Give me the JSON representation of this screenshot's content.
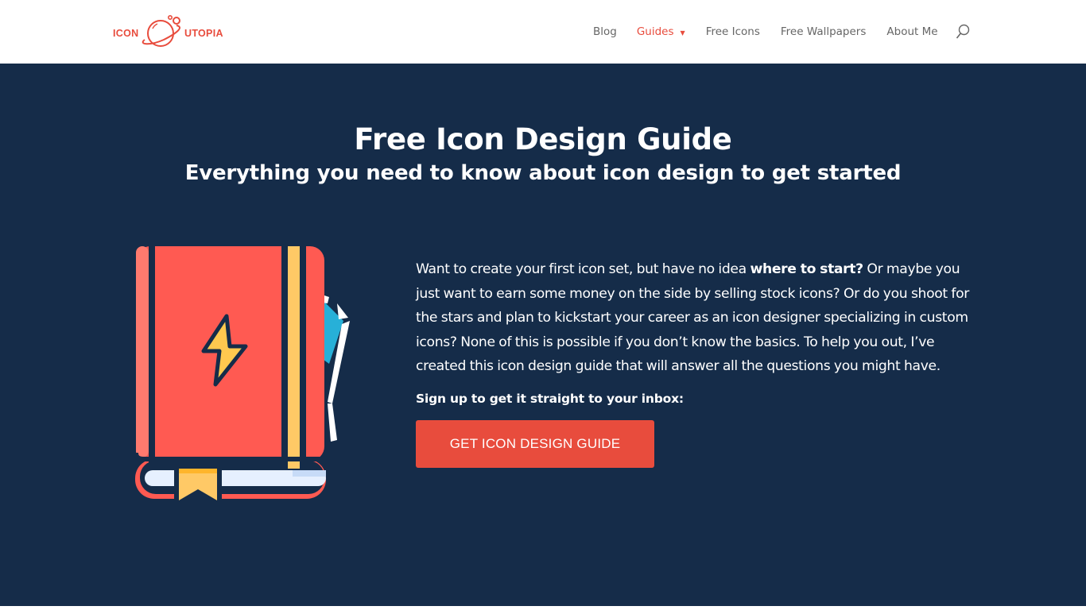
{
  "header": {
    "logo": {
      "text_left": "ICON",
      "text_right": "UTOPIA",
      "icon": "planet-icon"
    },
    "nav": [
      {
        "label": "Blog",
        "active": false
      },
      {
        "label": "Guides",
        "active": true,
        "dropdown_icon": "chevron-down-icon"
      },
      {
        "label": "Free Icons",
        "active": false
      },
      {
        "label": "Free Wallpapers",
        "active": false
      },
      {
        "label": "About Me",
        "active": false
      }
    ],
    "search_icon": "search-icon"
  },
  "hero": {
    "title": "Free Icon Design Guide",
    "subtitle": "Everything you need to know about icon design to get started",
    "illustration": "book-with-lightning-icon",
    "intro_before_bold": "Want to create your first icon set, but have no idea ",
    "intro_bold": "where to start?",
    "intro_after_bold": " Or maybe you just want to earn some money on the side by selling stock icons? Or do you shoot for the stars and plan to kickstart your career as an icon designer specializing in custom icons? None of this is possible if you don’t know the basics. To help you out, I’ve created this icon design guide that will answer all the questions you might have.",
    "signup_text": "Sign up to get it straight to your inbox:",
    "cta_label": "GET ICON DESIGN GUIDE"
  },
  "colors": {
    "accent": "#e84c3d",
    "hero_background": "#152c49",
    "nav_text": "#666666",
    "book_cover": "#ff5a52",
    "book_band": "#ffc966",
    "book_pages": "#e6f0ff",
    "pen_blue": "#27b0d8"
  }
}
